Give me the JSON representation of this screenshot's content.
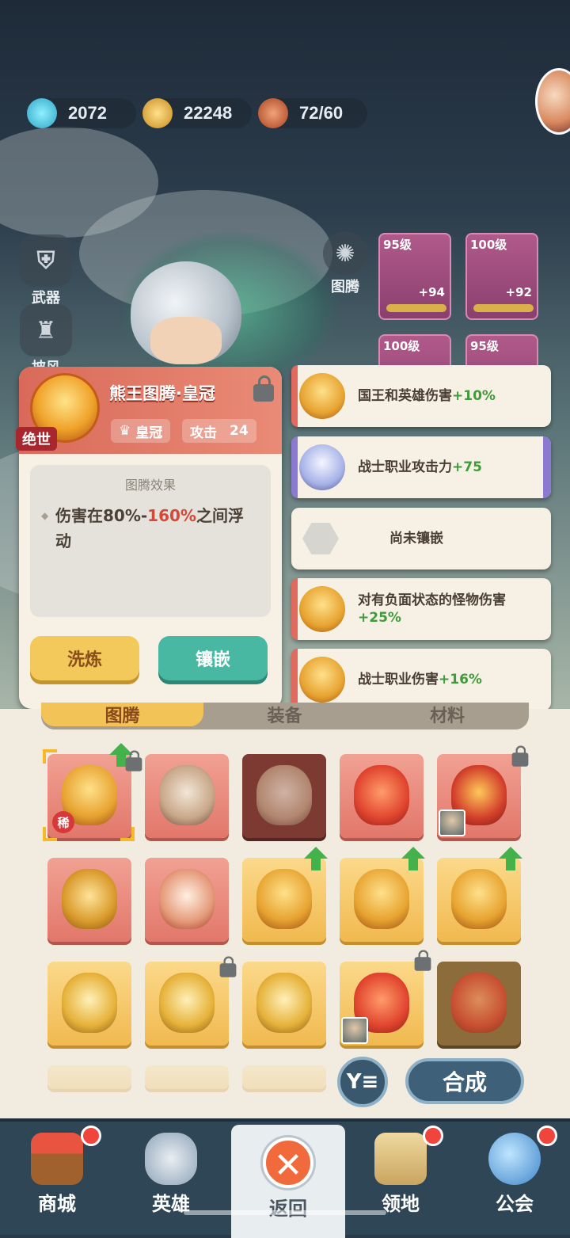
{
  "resources": {
    "gems": "2072",
    "gold": "22248",
    "stamina": "72/60"
  },
  "side": {
    "weapon": "武器",
    "cape": "披风",
    "totem": "图腾"
  },
  "gear_cards": [
    {
      "level": "95级",
      "plus": "+94"
    },
    {
      "level": "100级",
      "plus": "+92"
    },
    {
      "level": "100级",
      "plus": ""
    },
    {
      "level": "95级",
      "plus": ""
    }
  ],
  "detail": {
    "title": "熊王图腾·皇冠",
    "rarity": "绝世",
    "slot_type": "皇冠",
    "attack_label": "攻击",
    "attack_value": "24",
    "effect_title": "图腾效果",
    "effect_prefix": "伤害在80%-",
    "effect_red": "160%",
    "effect_suffix": "之间浮动",
    "wash_button": "洗炼",
    "inlay_button": "镶嵌"
  },
  "slots": [
    {
      "text": "国王和英雄伤害",
      "bonus": "+10%",
      "color": "#e06a5e"
    },
    {
      "text": "战士职业攻击力",
      "bonus": "+75",
      "color": "#8a7ad0"
    },
    {
      "text": "尚未镶嵌",
      "bonus": "",
      "color": ""
    },
    {
      "text": "对有负面状态的怪物伤害",
      "bonus": "+25%",
      "color": "#e06a5e"
    },
    {
      "text": "战士职业伤害",
      "bonus": "+16%",
      "color": "#e06a5e"
    }
  ],
  "inventory": {
    "tabs": [
      "图腾",
      "装备",
      "材料"
    ],
    "rare_label": "稀",
    "filter_label": "Y≡",
    "merge_button": "合成"
  },
  "nav": {
    "shop": "商城",
    "hero": "英雄",
    "back": "返回",
    "territory": "领地",
    "guild": "公会"
  }
}
